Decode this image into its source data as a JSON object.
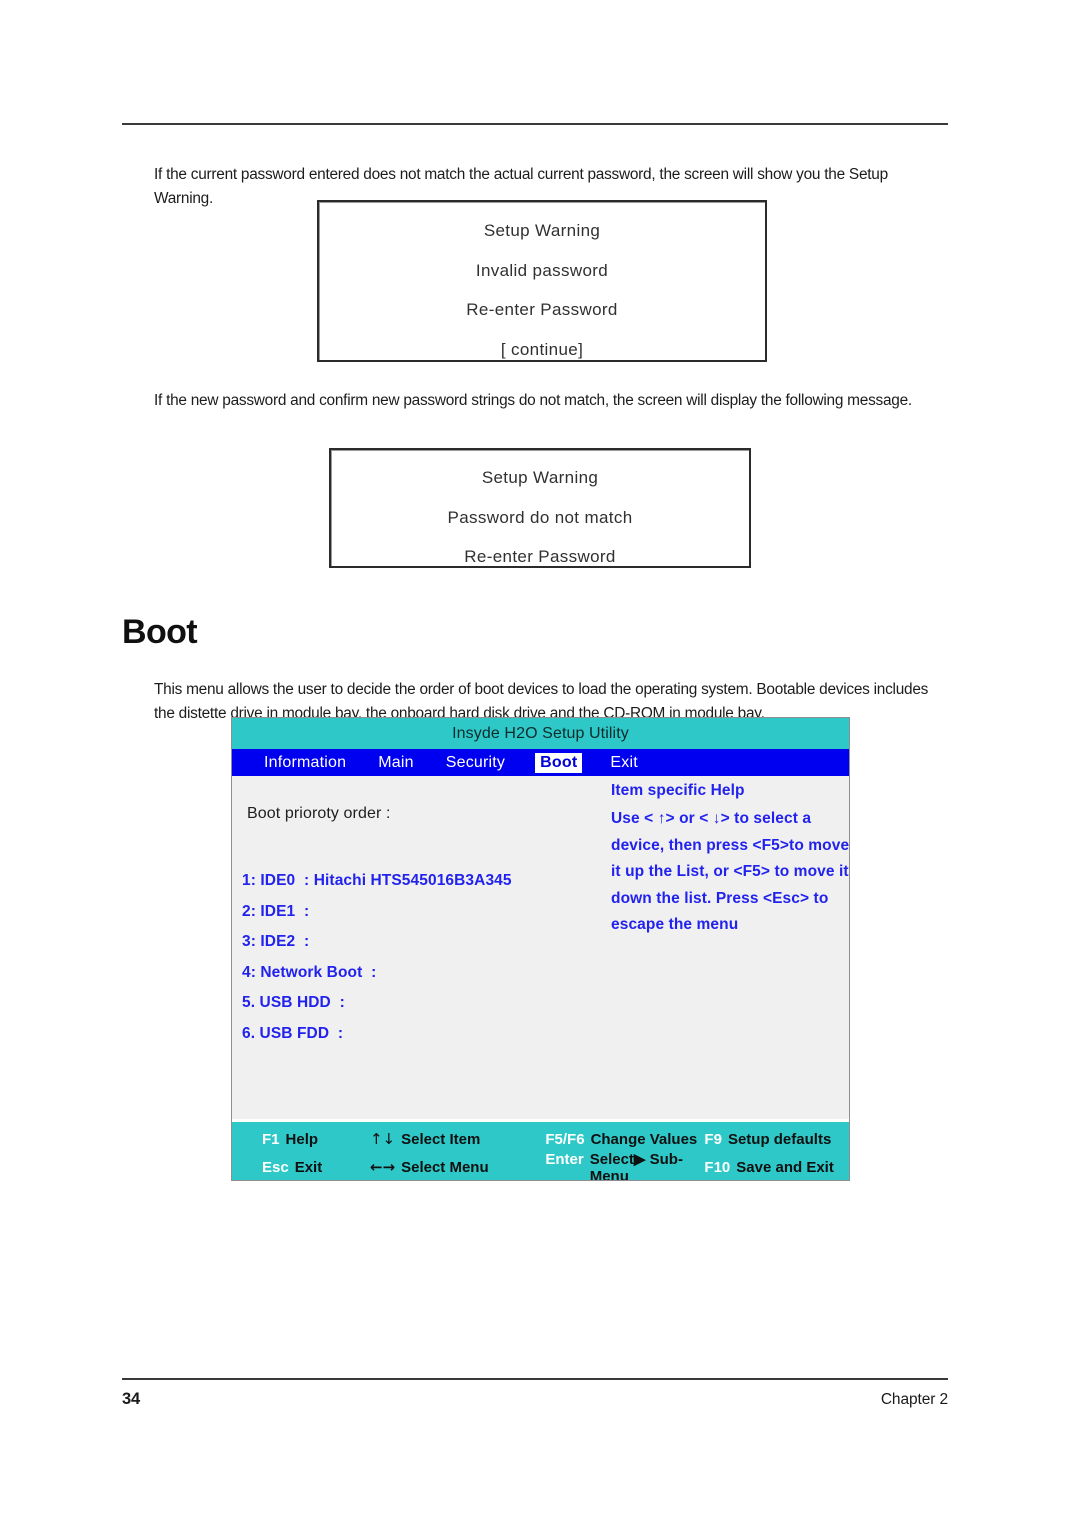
{
  "page": {
    "number": "34",
    "chapter": "Chapter 2"
  },
  "paragraphs": {
    "p1": "If the current password entered does not match the actual current password, the screen will show you the Setup Warning.",
    "p2": "If the new password and confirm new password strings do not match, the screen will display the following message.",
    "p3": "This menu allows the user to decide the order of boot devices to load the operating system. Bootable devices includes the distette drive in module bay, the onboard hard disk drive and the CD-ROM in module bay."
  },
  "section": {
    "title": "Boot"
  },
  "warning_dialog_1": {
    "lines": [
      "Setup Warning",
      "Invalid password",
      "Re-enter Password",
      "[ continue]"
    ]
  },
  "warning_dialog_2": {
    "lines": [
      "Setup Warning",
      "Password do not match",
      "Re-enter Password"
    ]
  },
  "bios": {
    "title": "Insyde H2O Setup Utility",
    "menu": [
      {
        "label": "Information",
        "active": false
      },
      {
        "label": "Main",
        "active": false
      },
      {
        "label": "Security",
        "active": false
      },
      {
        "label": "Boot",
        "active": true
      },
      {
        "label": "Exit",
        "active": false
      }
    ],
    "boot_order_label": "Boot prioroty order :",
    "boot_items": [
      "1: IDE0  : Hitachi HTS545016B3A345",
      "2: IDE1  :",
      "3: IDE2  :",
      "4: Network Boot  :",
      "5. USB HDD  :",
      "6. USB FDD  :"
    ],
    "help": {
      "title": "Item specific Help",
      "lines": [
        "Use < ↑> or <  ↓> to select a",
        "device, then press <F5>to move",
        "it up the List, or <F5> to move it",
        "down the list. Press <Esc> to",
        "escape the menu"
      ]
    },
    "footer": {
      "row1": [
        {
          "key": "F1",
          "desc": "Help"
        },
        {
          "key": "↑↓",
          "desc": "Select Item"
        },
        {
          "key": "F5/F6",
          "desc": "Change Values"
        },
        {
          "key": "F9",
          "desc": "Setup defaults"
        }
      ],
      "row2": [
        {
          "key": "Esc",
          "desc": "Exit"
        },
        {
          "key": "←→",
          "desc": "Select Menu"
        },
        {
          "key": "Enter",
          "desc": "Select▶ Sub-Menu"
        },
        {
          "key": "F10",
          "desc": "Save and Exit"
        }
      ]
    },
    "colors": {
      "titlebar": "#2fc8c8",
      "menubar": "#0000f0",
      "content_bg": "#f0f0f0",
      "accent_text": "#2222ee",
      "footer": "#2fc8c8"
    }
  }
}
